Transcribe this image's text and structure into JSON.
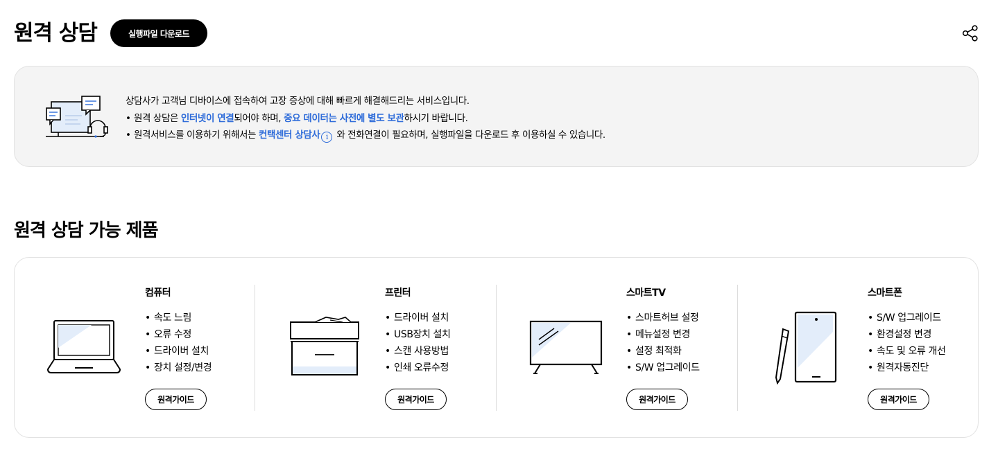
{
  "header": {
    "title": "원격 상담",
    "download_label": "실행파일 다운로드",
    "share_icon": "share-icon"
  },
  "info": {
    "line1": "상담사가 고객님 디바이스에 접속하여 고장 증상에 대해 빠르게 해결해드리는 서비스입니다.",
    "line2": {
      "bullet": "•",
      "a": "원격 상담은 ",
      "b": "인터넷이 연결",
      "c": "되어야 하며, ",
      "d": "중요 데이터는 사전에 별도 보관",
      "e": "하시기 바랍니다."
    },
    "line3": {
      "bullet": "•",
      "a": "원격서비스를 이용하기 위해서는 ",
      "b": "컨택센터 상담사",
      "icon": "i",
      "c": " 와 전화연결이 필요하며, 실행파일을 다운로드 후 이용하실 수 있습니다."
    },
    "highlight_color": "#2d6bd9"
  },
  "section": {
    "title": "원격 상담 가능 제품"
  },
  "products": [
    {
      "name": "컴퓨터",
      "icon": "laptop-icon",
      "features": [
        "속도 느림",
        "오류 수정",
        "드라이버 설치",
        "장치 설정/변경"
      ],
      "guide_label": "원격가이드"
    },
    {
      "name": "프린터",
      "icon": "printer-icon",
      "features": [
        "드라이버 설치",
        "USB장치 설치",
        "스캔 사용방법",
        "인쇄 오류수정"
      ],
      "guide_label": "원격가이드"
    },
    {
      "name": "스마트TV",
      "icon": "tv-icon",
      "features": [
        "스마트허브 설정",
        "메뉴설정 변경",
        "설정 최적화",
        "S/W 업그레이드"
      ],
      "guide_label": "원격가이드"
    },
    {
      "name": "스마트폰",
      "icon": "smartphone-icon",
      "features": [
        "S/W 업그레이드",
        "환경설정 변경",
        "속도 및 오류 개선",
        "원격자동진단"
      ],
      "guide_label": "원격가이드"
    }
  ]
}
